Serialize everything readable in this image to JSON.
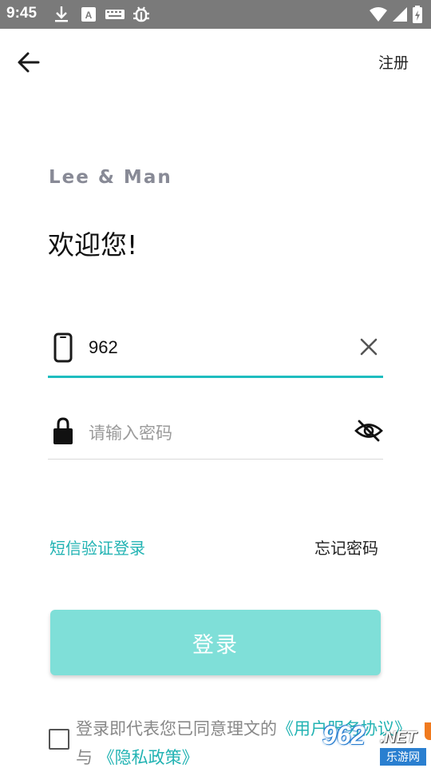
{
  "status_bar": {
    "time": "9:45",
    "icons": [
      "download-icon",
      "a-keyboard-icon",
      "keyboard-icon",
      "bug-icon",
      "wifi-icon",
      "signal-icon",
      "battery-icon"
    ]
  },
  "header": {
    "back_icon": "arrow-left-icon",
    "register_label": "注册"
  },
  "brand": {
    "logo_text": "Lee & Man",
    "welcome": "欢迎您!"
  },
  "form": {
    "phone": {
      "icon": "phone-icon",
      "value": "962",
      "clear_icon": "close-icon"
    },
    "password": {
      "icon": "lock-icon",
      "placeholder": "请输入密码",
      "visibility_icon": "eye-off-icon"
    }
  },
  "links": {
    "sms_login": "短信验证登录",
    "forgot_password": "忘记密码"
  },
  "login_button": "登录",
  "agreement": {
    "prefix": "登录即代表您已同意理文的",
    "user_agreement": "《用户服务协议》",
    "joiner": "与",
    "privacy_policy": "《隐私政策》"
  },
  "watermark": {
    "main": "962",
    "net": ".NET",
    "sub": "乐游网"
  },
  "colors": {
    "accent": "#1ebdbf",
    "button": "#7fdfd8",
    "status_bar": "#7a7a7a"
  }
}
